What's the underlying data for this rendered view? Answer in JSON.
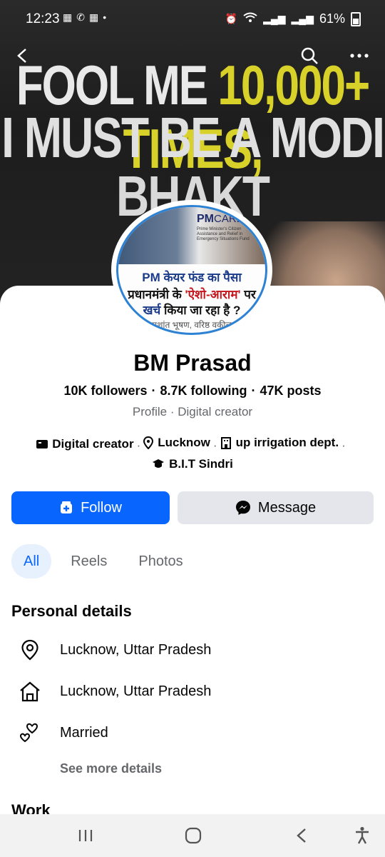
{
  "status_bar": {
    "time": "12:23",
    "left_icons": [
      "dainik-bhaskar-icon",
      "missed-call-icon",
      "dainik-bhaskar-icon",
      "dot-icon"
    ],
    "battery": "61%"
  },
  "cover": {
    "line1_part1": "FOOL ME ",
    "line1_highlight": "10,000+ TIMES,",
    "line2": "I MUST BE A MODI",
    "line3": "BHAKT"
  },
  "profile_picture": {
    "brand": "PM",
    "brand_suffix": "CARES",
    "brand_sub": "Prime Minister's Citizen Assistance and Relief in Emergency Situations Fund",
    "line1": "PM केयर फंड का पैसा",
    "line2_part1": "प्रधानमंत्री के ",
    "line2_highlight": "'ऐशो-आराम'",
    "line2_part2": " पर",
    "line3_highlight": "खर्च",
    "line3_rest": " किया जा रहा है ?",
    "line4": "प्रशांत भूषण, वरिष्ठ वकील"
  },
  "profile": {
    "name": "BM Prasad",
    "followers": "10K followers",
    "following": "8.7K following",
    "posts": "47K posts",
    "category": "Profile · Digital creator",
    "intro": {
      "creator": "Digital creator",
      "location": "Lucknow",
      "work": "up irrigation dept.",
      "education": "B.I.T Sindri"
    }
  },
  "actions": {
    "follow": "Follow",
    "message": "Message"
  },
  "tabs": [
    "All",
    "Reels",
    "Photos"
  ],
  "personal_details": {
    "title": "Personal details",
    "current_city": "Lucknow, Uttar Pradesh",
    "hometown": "Lucknow, Uttar Pradesh",
    "relationship": "Married",
    "see_more": "See more details"
  },
  "work": {
    "title": "Work"
  },
  "colors": {
    "accent": "#0866ff",
    "button_grey": "#e4e6eb",
    "secondary_text": "#65676b"
  }
}
